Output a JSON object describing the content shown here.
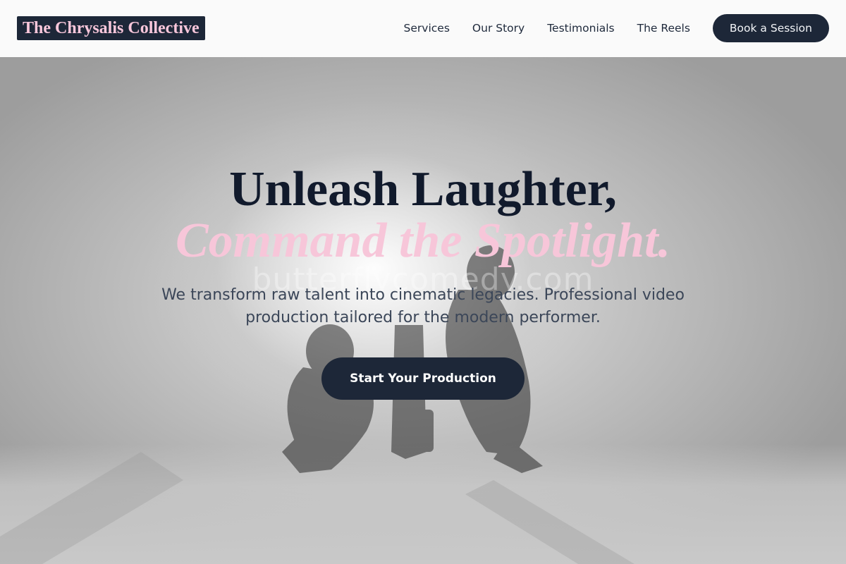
{
  "header": {
    "logo_text": "The Chrysalis Collective",
    "nav": [
      {
        "label": "Services"
      },
      {
        "label": "Our Story"
      },
      {
        "label": "Testimonials"
      },
      {
        "label": "The Reels"
      }
    ],
    "cta_label": "Book a Session"
  },
  "hero": {
    "headline_line1": "Unleash Laughter,",
    "headline_line2": "Command the Spotlight.",
    "subtitle": "We transform raw talent into cinematic legacies. Professional video production tailored for the modern performer.",
    "cta_label": "Start Your Production",
    "watermark": "butterflycomedy.com"
  },
  "colors": {
    "brand_dark": "#1d2738",
    "accent_pink": "#f7c6d9",
    "headline_dark": "#111a2c",
    "body_text": "#3b4658"
  }
}
